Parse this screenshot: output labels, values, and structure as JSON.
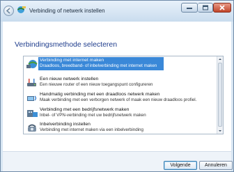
{
  "window": {
    "title": "Verbinding of netwerk instellen"
  },
  "content": {
    "heading": "Verbindingsmethode selecteren"
  },
  "options": [
    {
      "title": "Verbinding met internet maken",
      "subtitle": "Draadloos, breedband- of inbelverbinding met internet maken",
      "icon": "globe-network-icon",
      "selected": true
    },
    {
      "title": "Een nieuw netwerk instellen",
      "subtitle": "Een nieuwe router of een nieuw toegangspunt configureren",
      "icon": "router-icon",
      "selected": false
    },
    {
      "title": "Handmatig verbinding met een draadloos netwerk maken",
      "subtitle": "Maak verbinding met een verborgen netwerk of maak een nieuw draadloos profiel.",
      "icon": "wireless-computer-icon",
      "selected": false
    },
    {
      "title": "Verbinding met een bedrijfsnetwerk maken",
      "subtitle": "Inbel- of VPN-verbinding met uw bedrijfsnetwerk maken",
      "icon": "workplace-network-icon",
      "selected": false
    },
    {
      "title": "Inbelverbinding instellen",
      "subtitle": "Verbinding met internet maken via een inbelverbinding",
      "icon": "dialup-phone-icon",
      "selected": false
    }
  ],
  "buttons": {
    "next": "Volgende",
    "cancel": "Annuleren"
  },
  "colors": {
    "heading": "#1e3c8c",
    "selection": "#3a88d8"
  }
}
